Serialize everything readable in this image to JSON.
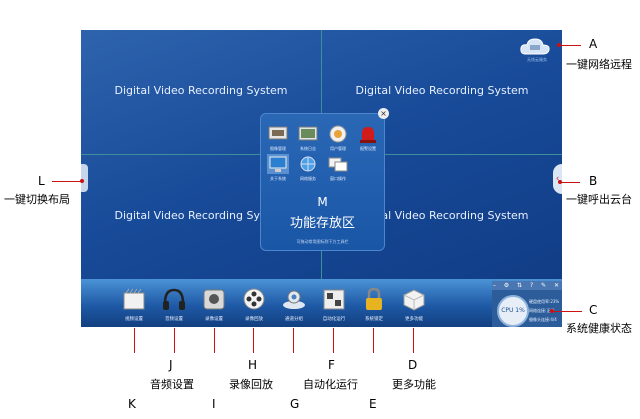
{
  "screen": {
    "pane_title": "Digital Video Recording System",
    "cloud_text": "无线云服务",
    "right_tab_glyph": "‹"
  },
  "panel": {
    "close_glyph": "×",
    "items": [
      "图像管理",
      "系统日志",
      "用户管理",
      "报警设置",
      "关于系统",
      "网络服务",
      "窗口操作"
    ],
    "letter": "M",
    "title": "功能存放区",
    "hint": "可拖动常用图标到下方工具栏"
  },
  "toolbar": {
    "items": [
      "视频设置",
      "音频设置",
      "录像设置",
      "录像回放",
      "通道分组",
      "自动化运行",
      "系统锁定",
      "更多功能"
    ]
  },
  "health": {
    "bar_glyphs": "– ⚙ ⇅ ? ✎ ✕",
    "cpu": "CPU 1%",
    "lines": [
      "硬盘使用率:23%",
      "网络连接:正常",
      "摄像头连接:4/4"
    ]
  },
  "annotations": {
    "A": {
      "letter": "A",
      "text": "一键网络远程"
    },
    "B": {
      "letter": "B",
      "text": "一键呼出云台"
    },
    "C": {
      "letter": "C",
      "text": "系统健康状态"
    },
    "L": {
      "letter": "L",
      "text": "一键切换布局"
    },
    "J": {
      "letter": "J",
      "text": "音频设置"
    },
    "H": {
      "letter": "H",
      "text": "录像回放"
    },
    "F": {
      "letter": "F",
      "text": "自动化运行"
    },
    "D": {
      "letter": "D",
      "text": "更多功能"
    },
    "bottom_letters": [
      "K",
      "I",
      "G",
      "E"
    ]
  },
  "colors": {
    "accent_line": "#c91313",
    "screen_bg": "#174a98"
  }
}
